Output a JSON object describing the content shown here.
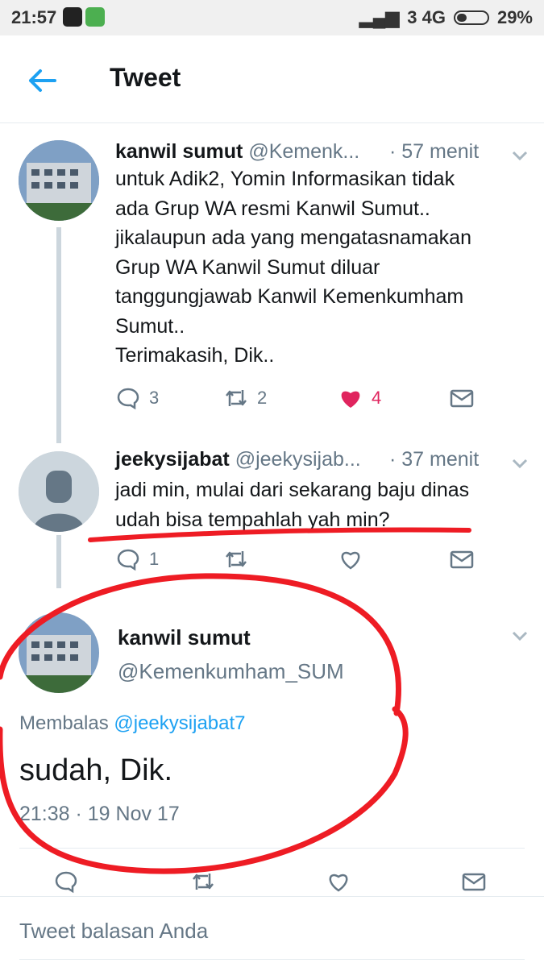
{
  "status_bar": {
    "time": "21:57",
    "network": "3 4G",
    "battery": "29%"
  },
  "app_bar": {
    "title": "Tweet"
  },
  "tweets": [
    {
      "name": "kanwil sumut",
      "handle": "@Kemenk...",
      "time_ago": "· 57 menit",
      "text": "untuk Adik2, Yomin Informasikan tidak\nada Grup WA resmi Kanwil Sumut..\njikalaupun ada yang mengatasnamakan\nGrup WA Kanwil Sumut diluar\ntanggungjawab Kanwil Kemenkumham\nSumut..\nTerimakasih, Dik..",
      "replies": "3",
      "retweets": "2",
      "likes": "4"
    },
    {
      "name": "jeekysijabat",
      "handle": "@jeekysijab...",
      "time_ago": "· 37 menit",
      "text": "jadi min, mulai dari sekarang baju dinas\nudah bisa tempahlah yah min?",
      "replies": "1"
    }
  ],
  "main_tweet": {
    "name": "kanwil sumut",
    "handle": "@Kemenkumham_SUM",
    "replying_prefix": "Membalas",
    "replying_to": "@jeekysijabat7",
    "text": "sudah, Dik.",
    "timestamp": "21:38 · 19 Nov 17"
  },
  "reply_box": {
    "placeholder": "Tweet balasan Anda"
  },
  "colors": {
    "twitter_blue": "#1da1f2",
    "like_red": "#e0245e",
    "annotation_red": "#ee1c24",
    "grey_text": "#657786"
  }
}
